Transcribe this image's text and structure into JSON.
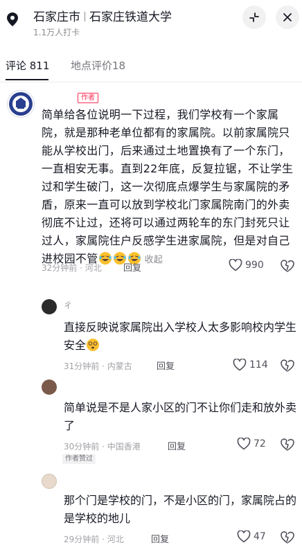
{
  "header": {
    "city": "石家庄市",
    "place": "石家庄铁道大学",
    "checkins": "1.1万人打卡",
    "pin_icon": "location-pin-icon",
    "collapse_icon": "collapse-icon",
    "close_icon": "close-icon"
  },
  "tabs": [
    {
      "label": "评论 811",
      "active": true
    },
    {
      "label": "地点评价18",
      "active": false
    }
  ],
  "main_comment": {
    "author_tag": "作者",
    "text": "简单给各位说明一下过程，我们学校有一个家属院，就是那种老单位都有的家属院。以前家属院只能从学校出门，后来通过土地置换有了一个东门，一直相安无事。直到22年底，反复拉锯，不让学生过和学生破门，这一次彻底点爆学生与家属院的矛盾，原来一直可以放到学校北门家属院南门的外卖彻底不让过，还将可以通过两轮车的东门封死只让过人，家属院住户反感学生进家属院，但是对自己进校园不管",
    "collapse_label": "收起",
    "time": "32分钟前",
    "region": "河北",
    "reply_label": "回复",
    "likes": "990"
  },
  "replies": [
    {
      "name": "ㄔ",
      "text": "直接反映说家属院出入学校人太多影响校内学生安全",
      "time": "31分钟前",
      "region": "内蒙古",
      "reply_label": "回复",
      "likes": "114"
    },
    {
      "name": "",
      "text": "简单说是不是人家小区的门不让你们走和放外卖了",
      "time": "30分钟前",
      "region": "中国香港",
      "reply_label": "回复",
      "likes": "72",
      "badge": "作者赞过"
    },
    {
      "name": "",
      "text": "那个门是学校的门，不是小区的门，家属院占的是学校的地儿",
      "time": "29分钟前",
      "region": "河北",
      "reply_label": "回复",
      "likes": "47"
    }
  ],
  "colors": {
    "accent": "#fe2c55",
    "text": "#161823",
    "muted": "#8a8b91"
  }
}
